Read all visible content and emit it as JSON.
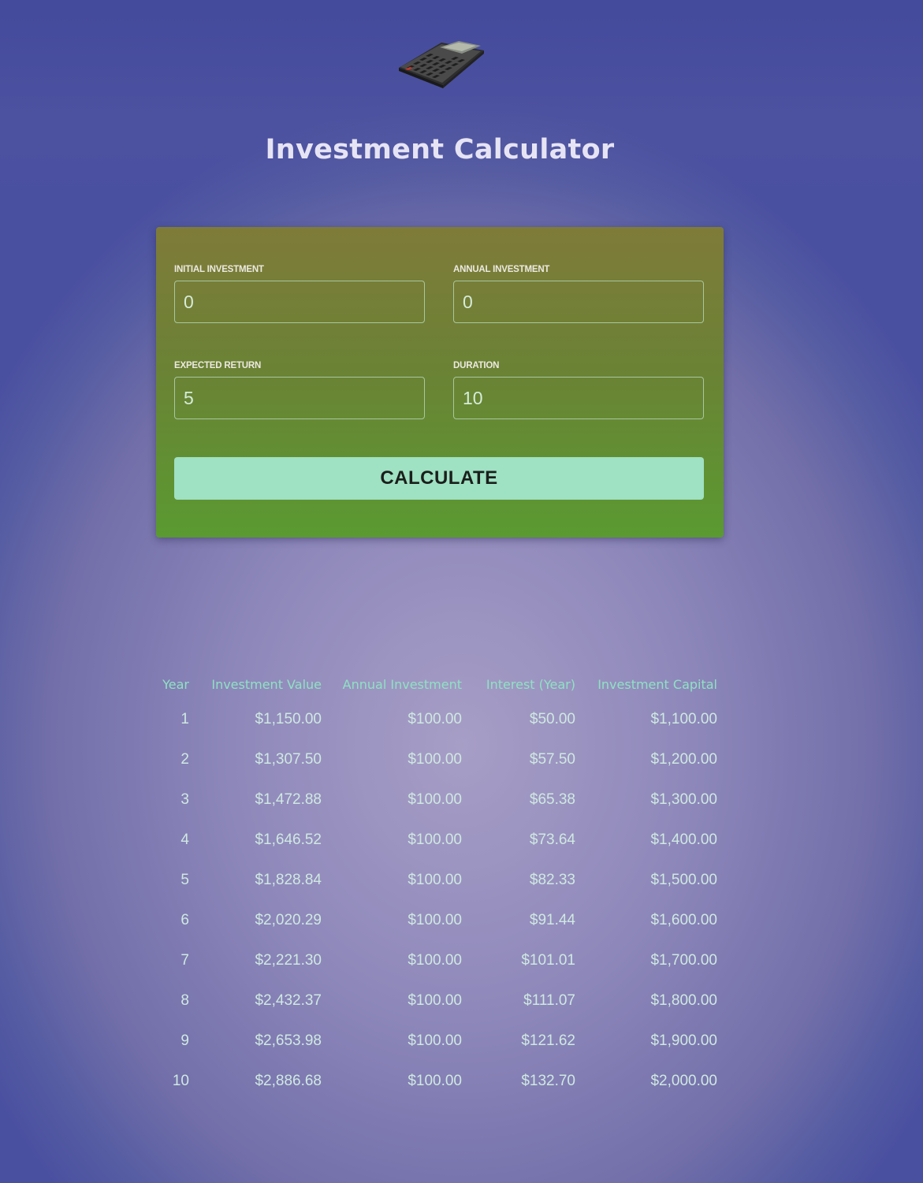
{
  "header": {
    "logo_icon": "calculator-icon",
    "title": "Investment Calculator"
  },
  "form": {
    "initial_investment": {
      "label": "Initial Investment",
      "value": "0"
    },
    "annual_investment": {
      "label": "Annual Investment",
      "value": "0"
    },
    "expected_return": {
      "label": "Expected Return",
      "value": "5"
    },
    "duration": {
      "label": "Duration",
      "value": "10"
    },
    "submit_label": "Calculate"
  },
  "results": {
    "columns": [
      "Year",
      "Investment Value",
      "Annual Investment",
      "Interest (Year)",
      "Investment Capital"
    ],
    "rows": [
      [
        "1",
        "$1,150.00",
        "$100.00",
        "$50.00",
        "$1,100.00"
      ],
      [
        "2",
        "$1,307.50",
        "$100.00",
        "$57.50",
        "$1,200.00"
      ],
      [
        "3",
        "$1,472.88",
        "$100.00",
        "$65.38",
        "$1,300.00"
      ],
      [
        "4",
        "$1,646.52",
        "$100.00",
        "$73.64",
        "$1,400.00"
      ],
      [
        "5",
        "$1,828.84",
        "$100.00",
        "$82.33",
        "$1,500.00"
      ],
      [
        "6",
        "$2,020.29",
        "$100.00",
        "$91.44",
        "$1,600.00"
      ],
      [
        "7",
        "$2,221.30",
        "$100.00",
        "$101.01",
        "$1,700.00"
      ],
      [
        "8",
        "$2,432.37",
        "$100.00",
        "$111.07",
        "$1,800.00"
      ],
      [
        "9",
        "$2,653.98",
        "$100.00",
        "$121.62",
        "$1,900.00"
      ],
      [
        "10",
        "$2,886.68",
        "$100.00",
        "$132.70",
        "$2,000.00"
      ]
    ]
  },
  "colors": {
    "background": "#8f89bb",
    "card_top": "#7f7b39",
    "card_bottom": "#5a9a31",
    "button": "#9fe1c3",
    "table_header": "#8ee2c3",
    "table_text": "#cfe9e1"
  }
}
